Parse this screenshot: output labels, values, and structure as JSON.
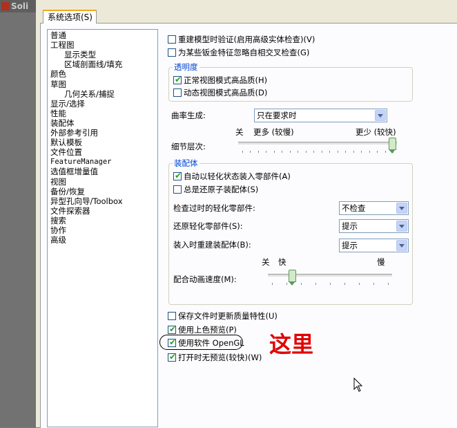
{
  "app": {
    "logo_text": "Soli"
  },
  "tabs": [
    {
      "label": "系统选项(S)"
    }
  ],
  "tree": [
    {
      "label": "普通",
      "indent": 0
    },
    {
      "label": "工程图",
      "indent": 0
    },
    {
      "label": "显示类型",
      "indent": 1
    },
    {
      "label": "区域剖面线/填充",
      "indent": 1
    },
    {
      "label": "颜色",
      "indent": 0
    },
    {
      "label": "草图",
      "indent": 0
    },
    {
      "label": "几何关系/捕捉",
      "indent": 1
    },
    {
      "label": "显示/选择",
      "indent": 0
    },
    {
      "label": "性能",
      "indent": 0,
      "selected": true
    },
    {
      "label": "装配体",
      "indent": 0
    },
    {
      "label": "外部参考引用",
      "indent": 0
    },
    {
      "label": "默认模板",
      "indent": 0
    },
    {
      "label": "文件位置",
      "indent": 0
    },
    {
      "label": "FeatureManager",
      "indent": 0,
      "mono": true
    },
    {
      "label": "选值框增量值",
      "indent": 0
    },
    {
      "label": "视图",
      "indent": 0
    },
    {
      "label": "备份/恢复",
      "indent": 0
    },
    {
      "label": "异型孔向导/Toolbox",
      "indent": 0
    },
    {
      "label": "文件探索器",
      "indent": 0
    },
    {
      "label": "搜索",
      "indent": 0
    },
    {
      "label": "协作",
      "indent": 0
    },
    {
      "label": "高级",
      "indent": 0
    }
  ],
  "performance": {
    "verify_rebuild": {
      "label": "重建模型时验证(启用高级实体检查)(V)",
      "checked": false
    },
    "ignore_self_intersect": {
      "label": "为某些钣金特征忽略自相交叉检查(G)",
      "checked": false
    },
    "transparency": {
      "title": "透明度",
      "normal_hq": {
        "label": "正常视图模式高品质(H)",
        "checked": true
      },
      "dynamic_hq": {
        "label": "动态视图模式高品质(D)",
        "checked": false
      }
    },
    "curvature": {
      "label": "曲率生成:",
      "value": "只在要求时"
    },
    "level_of_detail": {
      "label": "细节层次:",
      "off_label": "关",
      "more_label": "更多 (较慢)",
      "less_label": "更少 (较快)",
      "level": 1.0
    },
    "assemblies": {
      "title": "装配体",
      "auto_lightweight": {
        "label": "自动以轻化状态装入零部件(A)",
        "checked": true
      },
      "always_resolve": {
        "label": "总是还原子装配体(S)",
        "checked": false
      },
      "check_outdated": {
        "label": "检查过时的轻化零部件:",
        "value": "不检查"
      },
      "resolve_lightweight": {
        "label": "还原轻化零部件(S):",
        "value": "提示"
      },
      "rebuild_on_load": {
        "label": "装入时重建装配体(B):",
        "value": "提示"
      },
      "animation": {
        "label": "配合动画速度(M):",
        "off_label": "关",
        "fast_label": "快",
        "slow_label": "慢",
        "level": 0.18
      }
    },
    "save_mass_props": {
      "label": "保存文件时更新质量特性(U)",
      "checked": false
    },
    "shaded_preview": {
      "label": "使用上色预览(P)",
      "checked": true
    },
    "software_opengl": {
      "label": "使用软件 OpenGL",
      "checked": true
    },
    "no_preview_open": {
      "label": "打开时无预览(较快)(W)",
      "checked": true
    }
  },
  "annotation": {
    "text": "这里",
    "color": "#e00000"
  },
  "icons": [
    "checkbox-tick-icon",
    "dropdown-arrow-icon",
    "slider-thumb-icon",
    "mouse-cursor-icon",
    "app-logo-icon"
  ]
}
